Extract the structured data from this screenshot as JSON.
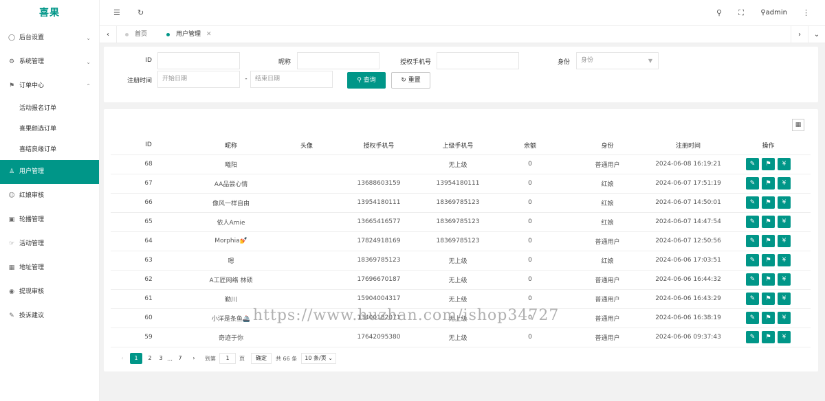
{
  "app": {
    "logo": "喜果"
  },
  "sidebar": {
    "items": [
      {
        "label": "后台设置",
        "arrow": "⌄"
      },
      {
        "label": "系统管理",
        "arrow": "⌄"
      },
      {
        "label": "订单中心",
        "arrow": "⌃"
      },
      {
        "label": "用户管理",
        "arrow": ""
      },
      {
        "label": "红娘审核",
        "arrow": ""
      },
      {
        "label": "轮播管理",
        "arrow": ""
      },
      {
        "label": "活动管理",
        "arrow": ""
      },
      {
        "label": "地址管理",
        "arrow": ""
      },
      {
        "label": "提现审核",
        "arrow": ""
      },
      {
        "label": "投诉建议",
        "arrow": ""
      }
    ],
    "submenu": [
      "活动报名订单",
      "喜果颜选订单",
      "喜结良缘订单"
    ]
  },
  "header": {
    "user": "admin"
  },
  "tabs": [
    {
      "label": "首页"
    },
    {
      "label": "用户管理"
    }
  ],
  "search": {
    "id_label": "ID",
    "nickname_label": "昵称",
    "phone_label": "授权手机号",
    "role_label": "身份",
    "role_placeholder": "身份",
    "date_label": "注册时间",
    "start_placeholder": "开始日期",
    "date_sep": "-",
    "end_placeholder": "结束日期",
    "query_label": "查询",
    "reset_label": "重置"
  },
  "table": {
    "headers": [
      "ID",
      "昵称",
      "头像",
      "授权手机号",
      "上级手机号",
      "余额",
      "身份",
      "注册时间",
      "操作"
    ],
    "rows": [
      {
        "id": "68",
        "nickname": "曦阳",
        "phone": "",
        "parent": "无上级",
        "balance": "0",
        "role": "普通用户",
        "time": "2024-06-08 16:19:21"
      },
      {
        "id": "67",
        "nickname": "AA品尝心情",
        "phone": "13688603159",
        "parent": "13954180111",
        "balance": "0",
        "role": "红娘",
        "time": "2024-06-07 17:51:19"
      },
      {
        "id": "66",
        "nickname": "像风一样自由",
        "phone": "13954180111",
        "parent": "18369785123",
        "balance": "0",
        "role": "红娘",
        "time": "2024-06-07 14:50:01"
      },
      {
        "id": "65",
        "nickname": "依人Amie",
        "phone": "13665416577",
        "parent": "18369785123",
        "balance": "0",
        "role": "红娘",
        "time": "2024-06-07 14:47:54"
      },
      {
        "id": "64",
        "nickname": "Morphia💅",
        "phone": "17824918169",
        "parent": "18369785123",
        "balance": "0",
        "role": "普通用户",
        "time": "2024-06-07 12:50:56"
      },
      {
        "id": "63",
        "nickname": "嗯",
        "phone": "18369785123",
        "parent": "无上级",
        "balance": "0",
        "role": "红娘",
        "time": "2024-06-06 17:03:51"
      },
      {
        "id": "62",
        "nickname": "A工匠网络 林硕",
        "phone": "17696670187",
        "parent": "无上级",
        "balance": "0",
        "role": "普通用户",
        "time": "2024-06-06 16:44:32"
      },
      {
        "id": "61",
        "nickname": "勤川",
        "phone": "15904004317",
        "parent": "无上级",
        "balance": "0",
        "role": "普通用户",
        "time": "2024-06-06 16:43:29"
      },
      {
        "id": "60",
        "nickname": "小洋是条鱼🚢",
        "phone": "13400182071",
        "parent": "无上级",
        "balance": "0",
        "role": "普通用户",
        "time": "2024-06-06 16:38:19"
      },
      {
        "id": "59",
        "nickname": "奇迹于你",
        "phone": "17642095380",
        "parent": "无上级",
        "balance": "0",
        "role": "普通用户",
        "time": "2024-06-06 09:37:43"
      }
    ]
  },
  "pagination": {
    "prev": "‹",
    "pages": [
      "1",
      "2",
      "3"
    ],
    "ellipsis": "…",
    "last": "7",
    "next": "›",
    "goto_label": "到第",
    "goto_value": "1",
    "page_unit": "页",
    "confirm": "确定",
    "total": "共 66 条",
    "page_size": "10 条/页"
  },
  "watermark": "https://www.huzhan.com/ishop34727",
  "colors": {
    "accent": "#009688",
    "background": "#f2f2f2"
  }
}
